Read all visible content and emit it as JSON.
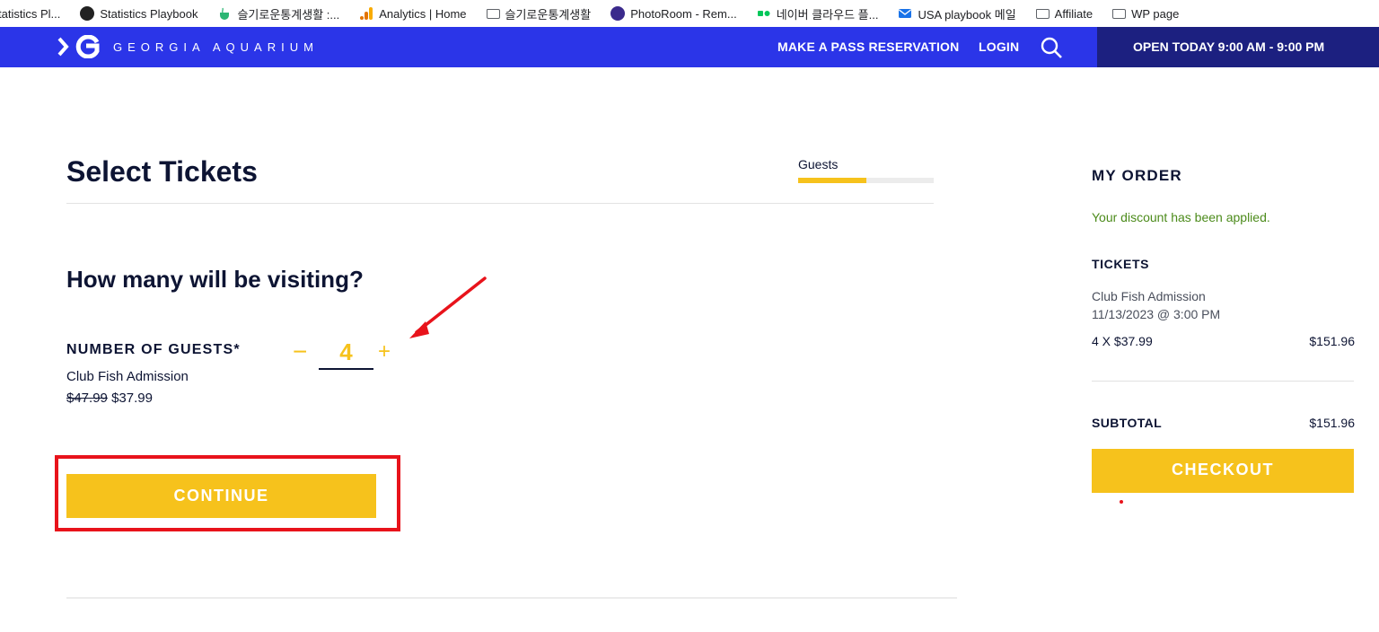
{
  "bookmarks": [
    {
      "label": "tatistics Pl...",
      "icon": "none"
    },
    {
      "label": "Statistics Playbook",
      "icon": "statistics-playbook-icon"
    },
    {
      "label": "슬기로운통계생활 :...",
      "icon": "cup-icon"
    },
    {
      "label": "Analytics | Home",
      "icon": "analytics-icon"
    },
    {
      "label": "슬기로운통계생활",
      "icon": "folder-icon"
    },
    {
      "label": "PhotoRoom - Rem...",
      "icon": "photoroom-icon"
    },
    {
      "label": "네이버 클라우드 플...",
      "icon": "naver-cloud-icon"
    },
    {
      "label": "USA playbook 메일",
      "icon": "mail-icon"
    },
    {
      "label": "Affiliate",
      "icon": "folder-icon"
    },
    {
      "label": "WP page",
      "icon": "folder-icon"
    }
  ],
  "header": {
    "brand": "GEORGIA AQUARIUM",
    "reservation_link": "MAKE A PASS RESERVATION",
    "login_link": "LOGIN",
    "hours": "OPEN TODAY 9:00 AM - 9:00 PM",
    "colors": {
      "bar": "#2b35e8",
      "hours_bg": "#1c2080"
    }
  },
  "main": {
    "title": "Select Tickets",
    "progress": {
      "label": "Guests",
      "fraction": 0.5
    },
    "question": "How many will be visiting?",
    "guests_label": "NUMBER OF GUESTS*",
    "ticket_name": "Club Fish Admission",
    "price_old": "$47.99",
    "price_new": "$37.99",
    "stepper": {
      "minus": "−",
      "value": "4",
      "plus": "+"
    },
    "continue_label": "CONTINUE",
    "accent_color": "#f6c21c"
  },
  "order": {
    "title": "MY ORDER",
    "discount_message": "Your discount has been applied.",
    "tickets_heading": "TICKETS",
    "item_name": "Club Fish Admission",
    "item_datetime": "11/13/2023 @ 3:00 PM",
    "quantity_line": "4 X $37.99",
    "line_total": "$151.96",
    "subtotal_label": "SUBTOTAL",
    "subtotal_value": "$151.96",
    "checkout_label": "CHECKOUT"
  },
  "annotations": {
    "color": "#e8131b"
  }
}
